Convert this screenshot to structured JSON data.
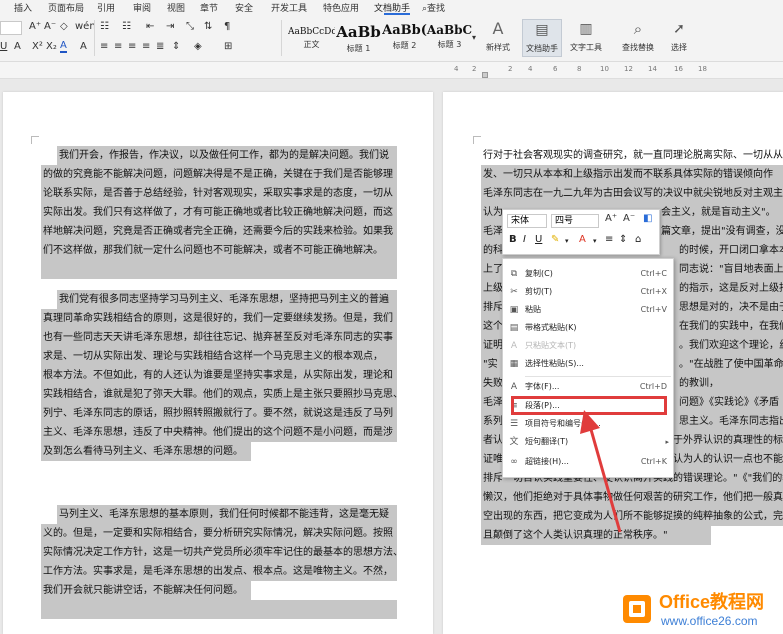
{
  "menu": {
    "items": [
      "插入",
      "页面布局",
      "引用",
      "审阅",
      "视图",
      "章节",
      "安全",
      "开发工具",
      "特色应用",
      "文档助手"
    ],
    "search": "查找"
  },
  "ribbon": {
    "styles": [
      {
        "sample": "AaBbCcDd",
        "name": "正文"
      },
      {
        "sample": "AaBb",
        "name": "标题 1"
      },
      {
        "sample": "AaBb(",
        "name": "标题 2"
      },
      {
        "sample": "AaBbC",
        "name": "标题 3"
      }
    ],
    "new_style": "新样式",
    "doc_assistant": "文档助手",
    "text_tools": "文字工具",
    "find_replace": "查找替换",
    "select": "选择"
  },
  "ruler": {
    "marks": [
      "4",
      "2",
      "2",
      "4",
      "6",
      "8",
      "10",
      "12",
      "14",
      "16",
      "18"
    ]
  },
  "page1": {
    "lines": [
      "我们开会，作报告，作决议，以及做任何工作，都为的是解决问题。我们说",
      "的做的究竟能不能解决问题，问题解决得是不是正确，关键在于我们是否能够理",
      "论联系实际，是否善于总结经验，针对客观现实，采取实事求是的态度，一切从",
      "实际出发。我们只有这样做了，才有可能正确地或者比较正确地解决问题，而这",
      "样地解决问题，究竟是否正确或者完全正确，还需要今后的实践来检验。如果我",
      "们不这样做，那我们就一定什么问题也不可能解决，或者不可能正确地解决。",
      "我们党有很多同志坚持学习马列主义、毛泽东思想，坚持把马列主义的普遍",
      "真理同革命实践相结合的原则，这是很好的，我们一定要继续发扬。但是，我们",
      "也有一些同志天天讲毛泽东思想，却往往忘记、抛弃甚至反对毛泽东同志的实事",
      "求是、一切从实际出发、理论与实践相结合这样一个马克思主义的根本观点，",
      "根本方法。不但如此，有的人还认为谁要是坚持实事求是，从实际出发，理论和",
      "实践相结合，谁就是犯了弥天大罪。他们的观点，实质上是主张只要照抄马克思、",
      "列宁、毛泽东同志的原话，照抄照转照搬就行了。要不然，就说这是违反了马列",
      "主义、毛泽东思想，违反了中央精神。他们提出的这个问题不是小问题，而是涉",
      "及到怎么看待马列主义、毛泽东思想的问题。",
      "马列主义、毛泽东思想的基本原则，我们任何时候都不能违背，这是毫无疑",
      "义的。但是，一定要和实际相结合，要分析研究实际情况，解决实际问题。按照",
      "实际情况决定工作方针，这是一切共产党员所必须牢牢记住的最基本的思想方法、",
      "工作方法。实事求是，是毛泽东思想的出发点、根本点。这是唯物主义。不然，",
      "我们开会就只能讲空话，不能解决任何问题。"
    ]
  },
  "page2": {
    "lines": [
      "行对于社会客观现实的调查研究，就一直同理论脱离实际、一切从从",
      "发、一切只从本本和上级指示出发而不联系具体实际的错误倾向作",
      "毛泽东同志在一九二九年为古田会议写的决议中就尖锐地反对主观主",
      "认为",
      "毛泽",
      "的科",
      "上了",
      "上级",
      "排斥",
      "这个",
      "证明",
      "\"实",
      "失败",
      "毛泽",
      "系列",
      "者认为，只有人们的社会实践，才是人们对于外界认识的真理性的标准",
      "证唯物论的认识论把实践提到第一的地位，认为人的认识一点也不能离开",
      "排斥一切否认实践重要性、使认识离开实践的错误理论。\"《\"我们的教",
      "懒汉，他们拒绝对于具体事物做任何艰苦的研究工作，他们把一般真理",
      "空出现的东西，把它变成为人们所不能够捉摸的纯粹抽象的公式，完全",
      "且颠倒了这个人类认识真理的正常秩序。\""
    ],
    "right_fragments": [
      "会主义，就是盲动主义\"。",
      "篇文章，提出\"没有调查，没",
      "的时候，开口闭口拿本本",
      "同志说：\"盲目地表面上完",
      "的指示，这是反对上级指示",
      "思想是对的，决不是由于",
      "在我们的实践中，在我们",
      "。我们欢迎这个理论，丝毫",
      "。\"在战胜了使中国革命",
      "的教训，",
      "问题》《实践论》《矛盾",
      "思主义。毛泽东同志指出：\""
    ]
  },
  "mini_toolbar": {
    "font": "宋体",
    "size": "四号"
  },
  "context_menu": {
    "items": [
      {
        "icon": "⧉",
        "label": "复制(C)",
        "shortcut": "Ctrl+C",
        "disabled": false
      },
      {
        "icon": "✂",
        "label": "剪切(T)",
        "shortcut": "Ctrl+X",
        "disabled": false
      },
      {
        "icon": "▣",
        "label": "粘贴",
        "shortcut": "Ctrl+V",
        "disabled": false
      },
      {
        "icon": "▤",
        "label": "带格式粘贴(K)",
        "shortcut": "",
        "disabled": false
      },
      {
        "icon": "A",
        "label": "只粘贴文本(T)",
        "shortcut": "",
        "disabled": true
      },
      {
        "icon": "▦",
        "label": "选择性粘贴(S)...",
        "shortcut": "",
        "disabled": false
      },
      {
        "icon": "A",
        "label": "字体(F)...",
        "shortcut": "Ctrl+D",
        "disabled": false
      },
      {
        "icon": "≡",
        "label": "段落(P)...",
        "shortcut": "",
        "disabled": false
      },
      {
        "icon": "☰",
        "label": "项目符号和编号(N)...",
        "shortcut": "",
        "disabled": false
      },
      {
        "icon": "文",
        "label": "短句翻译(T)",
        "shortcut": "",
        "disabled": false
      },
      {
        "icon": "∞",
        "label": "超链接(H)...",
        "shortcut": "Ctrl+K",
        "disabled": false
      }
    ]
  },
  "watermark": {
    "title": "Office教程网",
    "url": "www.office26.com"
  },
  "colors": {
    "highlight": "#e03c3c",
    "selection": "#c6c6c6"
  }
}
